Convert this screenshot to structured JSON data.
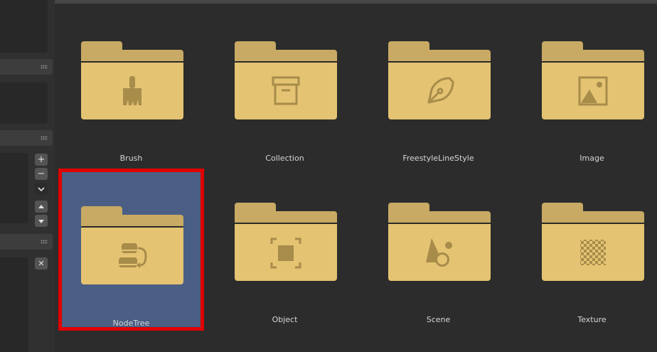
{
  "sidebar": {
    "buttons": {
      "add": "+",
      "remove": "−",
      "expand_icon": "chevron-down-icon",
      "move_up_icon": "triangle-up-icon",
      "move_down_icon": "triangle-down-icon",
      "close": "✕"
    }
  },
  "browser": {
    "items": [
      {
        "label": "Brush",
        "icon": "brush-icon",
        "selected": false
      },
      {
        "label": "Collection",
        "icon": "archive-box-icon",
        "selected": false
      },
      {
        "label": "FreestyleLineStyle",
        "icon": "pen-nib-icon",
        "selected": false
      },
      {
        "label": "Image",
        "icon": "image-icon",
        "selected": false
      },
      {
        "label": "NodeTree",
        "icon": "node-tree-icon",
        "selected": true
      },
      {
        "label": "Object",
        "icon": "object-cube-icon",
        "selected": false
      },
      {
        "label": "Scene",
        "icon": "scene-shapes-icon",
        "selected": false
      },
      {
        "label": "Texture",
        "icon": "checkerboard-texture-icon",
        "selected": false
      }
    ]
  },
  "colors": {
    "folder_front": "#e4c372",
    "folder_back": "#c8aa64",
    "icon": "#a78c4a",
    "selection_bg": "#4a5f83",
    "highlight_border": "#e00000"
  }
}
